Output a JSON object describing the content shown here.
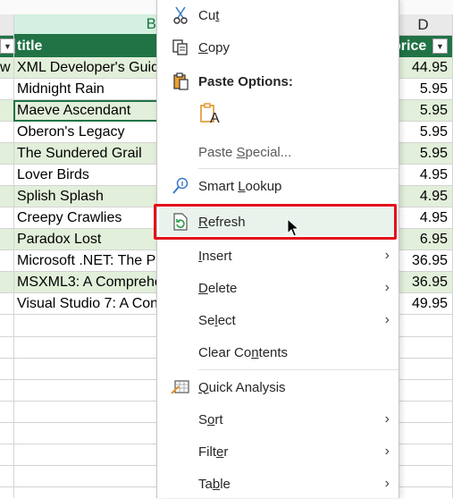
{
  "sheet": {
    "columns": [
      {
        "letter": "B"
      },
      {
        "letter": "D"
      }
    ],
    "header": {
      "title": "title",
      "price_partial": "price"
    },
    "rows": [
      {
        "lead": "w",
        "title": "XML Developer's Guid",
        "price": "44.95"
      },
      {
        "title": "Midnight Rain",
        "price": "5.95"
      },
      {
        "title": "Maeve Ascendant",
        "price": "5.95"
      },
      {
        "title": "Oberon's Legacy",
        "price": "5.95"
      },
      {
        "title": "The Sundered Grail",
        "price": "5.95"
      },
      {
        "title": "Lover Birds",
        "price": "4.95"
      },
      {
        "title": "Splish Splash",
        "price": "4.95"
      },
      {
        "title": "Creepy Crawlies",
        "price": "4.95"
      },
      {
        "title": "Paradox Lost",
        "price": "6.95"
      },
      {
        "title": "Microsoft .NET: The P",
        "price": "36.95"
      },
      {
        "title": "MSXML3: A Comprehe",
        "price": "36.95"
      },
      {
        "title": "Visual Studio 7: A Con",
        "price": "49.95"
      }
    ]
  },
  "menu": {
    "cut": {
      "pre": "Cu",
      "key": "t",
      "post": "",
      "icon": "scissors-icon"
    },
    "copy": {
      "pre": "",
      "key": "C",
      "post": "opy",
      "icon": "copy-icon"
    },
    "paste_options": {
      "label": "Paste Options:",
      "icon": "clipboard-icon"
    },
    "paste_icon": {
      "letter": "A",
      "icon": "paste-text-only-icon"
    },
    "paste_special": {
      "pre": "Paste ",
      "key": "S",
      "post": "pecial..."
    },
    "smart_lookup": {
      "pre": "Smart ",
      "key": "L",
      "post": "ookup",
      "icon": "smart-lookup-icon"
    },
    "refresh": {
      "pre": "",
      "key": "R",
      "post": "efresh",
      "icon": "refresh-icon"
    },
    "insert": {
      "pre": "",
      "key": "I",
      "post": "nsert"
    },
    "delete": {
      "pre": "",
      "key": "D",
      "post": "elete"
    },
    "select": {
      "pre": "Se",
      "key": "l",
      "post": "ect"
    },
    "clear_contents": {
      "pre": "Clear Co",
      "key": "n",
      "post": "tents"
    },
    "quick_analysis": {
      "pre": "",
      "key": "Q",
      "post": "uick Analysis",
      "icon": "quick-analysis-icon"
    },
    "sort": {
      "pre": "S",
      "key": "o",
      "post": "rt"
    },
    "filter": {
      "pre": "Filt",
      "key": "e",
      "post": "r"
    },
    "table": {
      "pre": "Ta",
      "key": "b",
      "post": "le"
    }
  },
  "colors": {
    "accent": "#217346",
    "band": "#e2efda",
    "highlight": "#e1121b"
  }
}
